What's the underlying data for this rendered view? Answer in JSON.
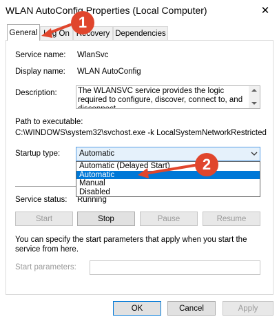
{
  "window": {
    "title": "WLAN AutoConfig Properties (Local Computer)",
    "close_glyph": "✕"
  },
  "tabs": [
    {
      "label": "General",
      "active": true
    },
    {
      "label": "Log On",
      "active": false
    },
    {
      "label": "Recovery",
      "active": false
    },
    {
      "label": "Dependencies",
      "active": false
    }
  ],
  "general": {
    "service_name_label": "Service name:",
    "service_name_value": "WlanSvc",
    "display_name_label": "Display name:",
    "display_name_value": "WLAN AutoConfig",
    "description_label": "Description:",
    "description_value": "The WLANSVC service provides the logic required to configure, discover, connect to, and disconnect",
    "path_label": "Path to executable:",
    "path_value": "C:\\WINDOWS\\system32\\svchost.exe -k LocalSystemNetworkRestricted",
    "startup_type_label": "Startup type:",
    "startup_type_selected": "Automatic",
    "startup_options": [
      {
        "label": "Automatic (Delayed Start)",
        "selected": false
      },
      {
        "label": "Automatic",
        "selected": true
      },
      {
        "label": "Manual",
        "selected": false
      },
      {
        "label": "Disabled",
        "selected": false
      }
    ],
    "service_status_label": "Service status:",
    "service_status_value": "Running",
    "start_button": "Start",
    "stop_button": "Stop",
    "pause_button": "Pause",
    "resume_button": "Resume",
    "params_hint": "You can specify the start parameters that apply when you start the service from here.",
    "start_params_label": "Start parameters:",
    "start_params_value": ""
  },
  "footer": {
    "ok_button": "OK",
    "cancel_button": "Cancel",
    "apply_button": "Apply"
  },
  "annotations": [
    {
      "number": "1",
      "color": "#e0462d"
    },
    {
      "number": "2",
      "color": "#e0462d"
    }
  ],
  "colors": {
    "accent": "#0078d7",
    "annotation": "#e0462d"
  }
}
